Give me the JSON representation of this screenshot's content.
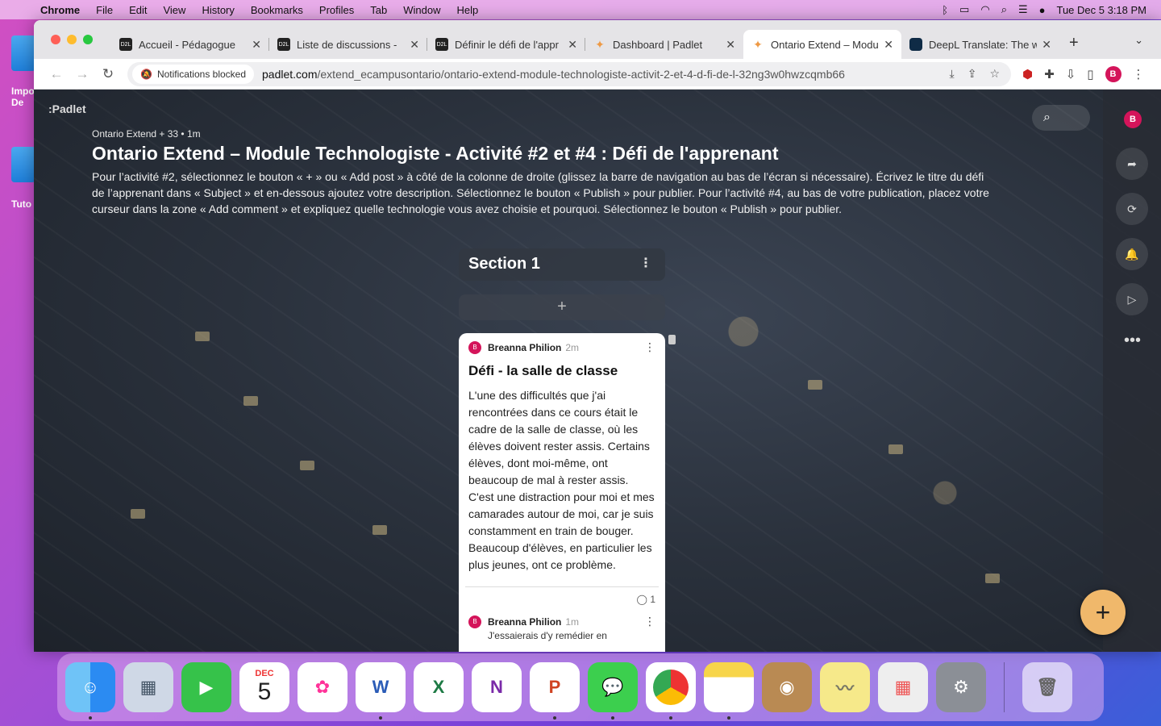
{
  "menubar": {
    "app": "Chrome",
    "items": [
      "File",
      "Edit",
      "View",
      "History",
      "Bookmarks",
      "Profiles",
      "Tab",
      "Window",
      "Help"
    ],
    "datetime": "Tue Dec 5  3:18 PM"
  },
  "desktop": {
    "icon1_label": "Impo\nDe",
    "icon2_label": "Tuto"
  },
  "tabs": [
    {
      "title": "Accueil - Pédagogue",
      "favicon": "D2L",
      "active": false
    },
    {
      "title": "Liste de discussions -",
      "favicon": "D2L",
      "active": false
    },
    {
      "title": "Définir le défi de l'appr",
      "favicon": "D2L",
      "active": false
    },
    {
      "title": "Dashboard | Padlet",
      "favicon": "padlet",
      "active": false
    },
    {
      "title": "Ontario Extend – Modu",
      "favicon": "padlet",
      "active": true
    },
    {
      "title": "DeepL Translate: The w",
      "favicon": "deepl",
      "active": false
    }
  ],
  "toolbar": {
    "notif_chip": "Notifications blocked",
    "url_domain": "padlet.com",
    "url_path": "/extend_ecampusontario/ontario-extend-module-technologiste-activit-2-et-4-d-fi-de-l-32ng3w0hwzcqmb66",
    "profile_initial": "B"
  },
  "padlet": {
    "logo": ":Padlet",
    "meta": "Ontario Extend + 33 •  1m",
    "title": "Ontario Extend – Module Technologiste - Activité #2 et #4 : Défi de l'apprenant",
    "description": "Pour l’activité #2, sélectionnez le bouton « + » ou « Add post » à côté de la colonne de droite (glissez la barre de navigation au bas de l’écran si nécessaire). Écrivez le titre du défi de l’apprenant dans « Subject » et en-dessous ajoutez votre description. Sélectionnez le bouton « Publish » pour publier. Pour l’activité #4, au bas de votre publication, placez votre curseur dans la zone « Add comment » et expliquez quelle technologie vous avez choisie et pourquoi. Sélectionnez le bouton « Publish » pour publier.",
    "avatar_initial": "B",
    "section_title": "Section 1",
    "post": {
      "author": "Breanna Philion",
      "time": "2m",
      "avatar_initial": "B",
      "title": "Défi - la salle de classe",
      "body": "L'une des difficultés que j'ai rencontrées dans ce cours était le cadre de la salle de classe, où les élèves doivent rester assis. Certains élèves, dont moi-même, ont beaucoup de mal à rester assis. C'est une distraction pour moi et mes camarades autour de moi, car je suis constamment en train de bouger. Beaucoup d'élèves, en particulier les plus jeunes, ont ce problème.",
      "comment_count": "1",
      "comment": {
        "author": "Breanna Philion",
        "time": "1m",
        "text": "J'essaierais d'y remédier en"
      }
    }
  },
  "dock": {
    "calendar_month": "DEC",
    "calendar_day": "5",
    "apps": [
      "finder",
      "preview",
      "facetime",
      "calendar",
      "photos",
      "word",
      "excel",
      "onenote",
      "powerpoint",
      "messages",
      "chrome",
      "notes",
      "contacts",
      "stickies",
      "launchpad",
      "system-preferences",
      "trash"
    ]
  },
  "colors": {
    "accent_pink": "#d4145a",
    "fab": "#f0b86b"
  }
}
